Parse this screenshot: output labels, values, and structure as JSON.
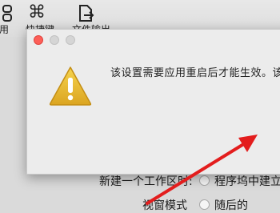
{
  "toolbar": {
    "items": [
      {
        "label": "用",
        "icon": "device-icon"
      },
      {
        "label": "快捷键",
        "icon": "command-icon"
      },
      {
        "label": "文件输出",
        "icon": "export-icon"
      }
    ]
  },
  "background": {
    "workspace_label": "新建一个工作区时:",
    "option_project": "程序坞中建立",
    "row2_partial_label": "视窗模式",
    "row2_option": "随后的"
  },
  "dialog": {
    "message": "该设置需要应用重启后才能生效。该",
    "icon": "warning-icon"
  },
  "colors": {
    "arrow": "#e31d1d",
    "close_button": "#fd5f58",
    "warning_fill": "#e9b733"
  }
}
